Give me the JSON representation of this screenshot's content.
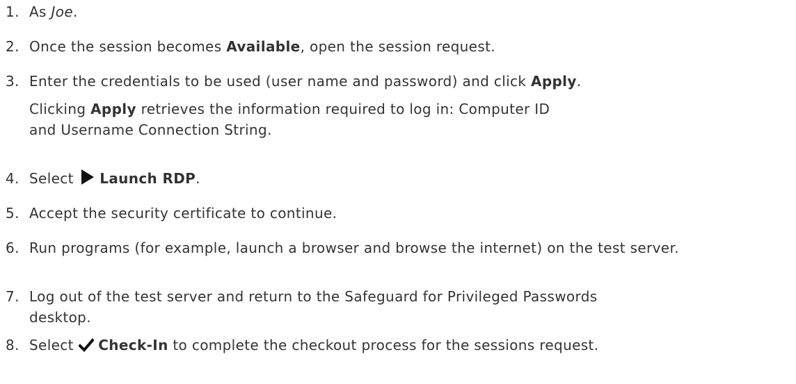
{
  "steps": [
    {
      "number": "1.",
      "pre": "As ",
      "em": "Joe",
      "post": "."
    },
    {
      "number": "2.",
      "pre": "Once the session becomes ",
      "bold": "Available",
      "post": ", open the session request."
    },
    {
      "number": "3.",
      "pre": "Enter the credentials to be used (user name and password) and click ",
      "bold": "Apply",
      "post": ".",
      "note": {
        "pre": "Clicking ",
        "bold": "Apply",
        "post": " retrieves the information required to log in: Computer ID and Username Connection String."
      }
    },
    {
      "number": "4.",
      "pre": "Select ",
      "icon": "play-arrow-icon",
      "bold": "Launch RDP",
      "post": "."
    },
    {
      "number": "5.",
      "text": "Accept the security certificate to continue."
    },
    {
      "number": "6.",
      "text": "Run programs (for example, launch a browser and browse the internet) on the test server."
    },
    {
      "number": "7.",
      "text": "Log out of the test server and return to the Safeguard for Privileged Passwords  desktop."
    },
    {
      "number": "8.",
      "pre": "Select ",
      "icon": "checkmark-icon",
      "bold": "Check-In",
      "post": " to complete the checkout process for the sessions request."
    }
  ],
  "colors": {
    "text": "#333333",
    "icon": "#111111"
  }
}
